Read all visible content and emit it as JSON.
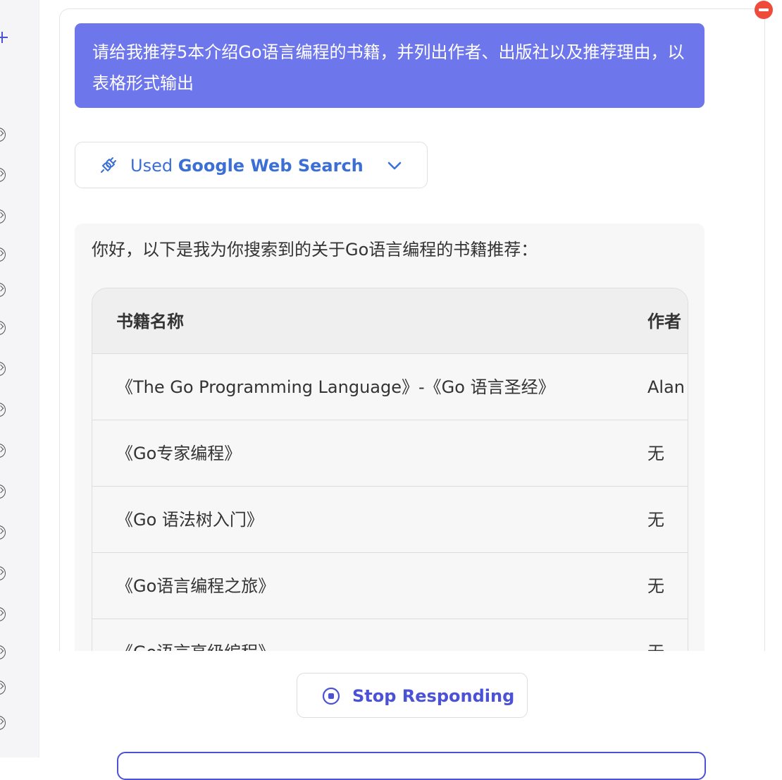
{
  "user_message": {
    "text": "请给我推荐5本介绍Go语言编程的书籍，并列出作者、出版社以及推荐理由，以表格形式输出"
  },
  "tool_usage": {
    "prefix": "Used",
    "tool_name": "Google Web Search",
    "icon": "plug-icon",
    "expand_icon": "chevron-down-icon"
  },
  "assistant_message": {
    "intro": "你好，以下是我为你搜索到的关于Go语言编程的书籍推荐："
  },
  "table": {
    "headers": [
      "书籍名称",
      "作者"
    ],
    "rows": [
      [
        "《The Go Programming Language》-《Go 语言圣经》",
        "Alan"
      ],
      [
        "《Go专家编程》",
        "无"
      ],
      [
        "《Go 语法树入门》",
        "无"
      ],
      [
        "《Go语言编程之旅》",
        "无"
      ],
      [
        "《Go语言高级编程》",
        "无"
      ]
    ]
  },
  "stop_button": {
    "label": "Stop Responding",
    "icon": "stop-circle-icon"
  },
  "colors": {
    "user_bubble": "#6e76eb",
    "tool_text": "#3b6fd6",
    "stop_button_text": "#4b52d6",
    "remove_badge": "#ee4b3b",
    "answer_card": "#f7f7f8"
  }
}
